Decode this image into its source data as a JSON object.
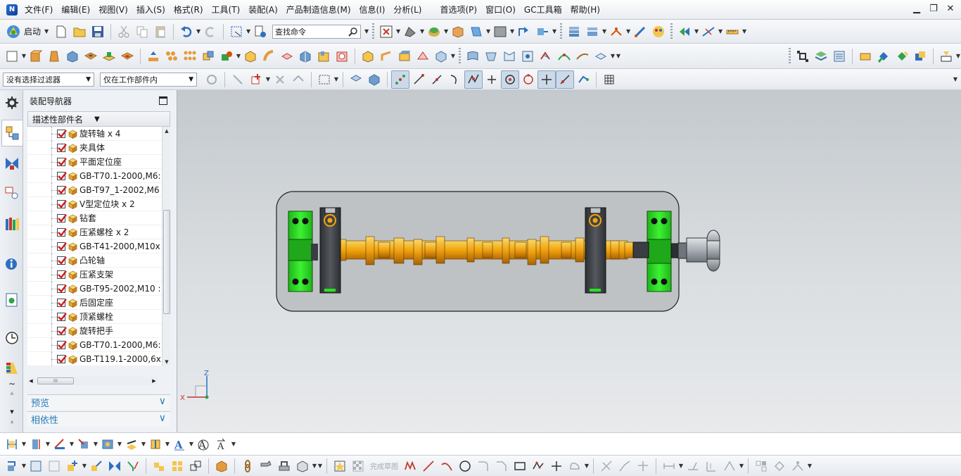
{
  "menubar": {
    "items": [
      "文件(F)",
      "编辑(E)",
      "视图(V)",
      "插入(S)",
      "格式(R)",
      "工具(T)",
      "装配(A)",
      "产品制造信息(M)",
      "信息(I)",
      "分析(L)",
      "首选项(P)",
      "窗口(O)",
      "GC工具箱",
      "帮助(H)"
    ]
  },
  "toolbar": {
    "start_label": "启动",
    "find_placeholder": "查找命令"
  },
  "selection_bar": {
    "filter_value": "没有选择过滤器",
    "scope_value": "仅在工作部件内"
  },
  "navigator": {
    "title": "装配导航器",
    "column_header": "描述性部件名",
    "rows": [
      {
        "label": "旋转轴 x 4",
        "checked": true
      },
      {
        "label": "夹具体",
        "checked": true
      },
      {
        "label": "平面定位座",
        "checked": true
      },
      {
        "label": "GB-T70.1-2000,M6:",
        "checked": true
      },
      {
        "label": "GB-T97_1-2002,M6",
        "checked": true
      },
      {
        "label": "V型定位块 x 2",
        "checked": true
      },
      {
        "label": "钻套",
        "checked": true
      },
      {
        "label": "压紧螺栓 x 2",
        "checked": true
      },
      {
        "label": "GB-T41-2000,M10x",
        "checked": true
      },
      {
        "label": "凸轮轴",
        "checked": true
      },
      {
        "label": "压紧支架",
        "checked": true
      },
      {
        "label": "GB-T95-2002,M10 :",
        "checked": true
      },
      {
        "label": "后固定座",
        "checked": true
      },
      {
        "label": "顶紧螺栓",
        "checked": true
      },
      {
        "label": "旋转把手",
        "checked": true
      },
      {
        "label": "GB-T70.1-2000,M6:",
        "checked": true
      },
      {
        "label": "GB-T119.1-2000,6x",
        "checked": true
      }
    ],
    "panels": [
      "预览",
      "相依性"
    ]
  },
  "viewport": {
    "triad": {
      "x_label": "X",
      "z_label": "Z"
    }
  },
  "bottom_toolbar": {
    "sketch_done_label": "完成草图"
  },
  "colors": {
    "accent": "#2a7ab8",
    "green_part": "#27e31f",
    "shaft": "#f2a50c",
    "dark_part": "#3a3d42"
  }
}
